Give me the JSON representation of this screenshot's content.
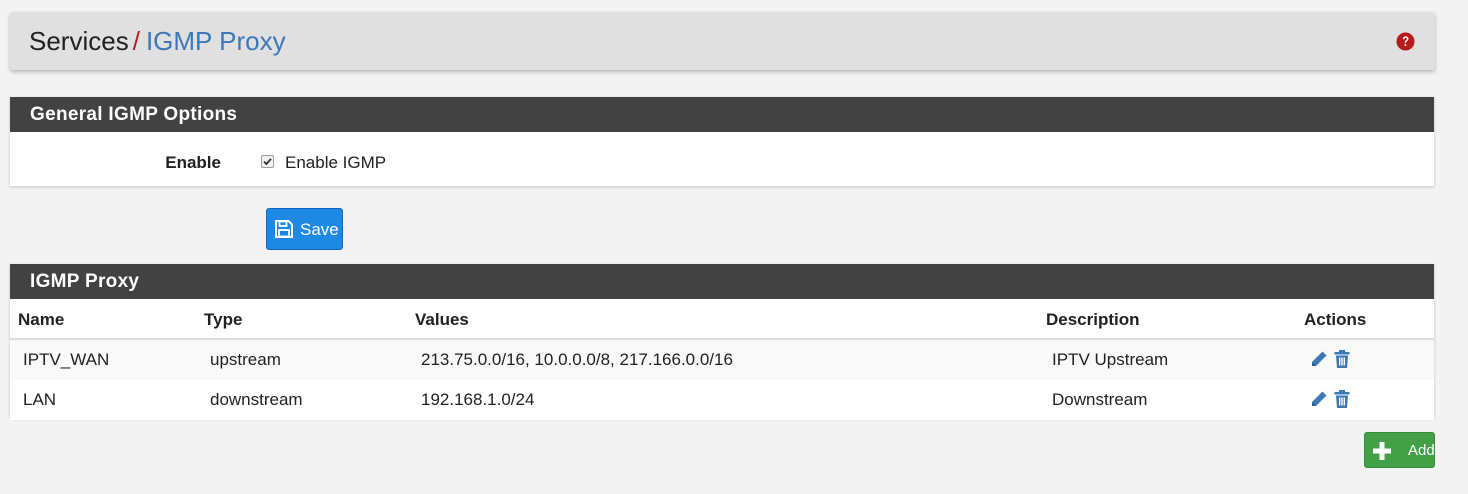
{
  "breadcrumb": {
    "parent": "Services",
    "separator": "/",
    "current": "IGMP Proxy",
    "help_icon": "question-circle-icon"
  },
  "general_panel": {
    "title": "General IGMP Options",
    "enable_label": "Enable",
    "enable_checkbox_label": "Enable IGMP",
    "enable_checked": true
  },
  "save_button": {
    "label": "Save",
    "icon": "floppy-disk-icon"
  },
  "proxy_panel": {
    "title": "IGMP Proxy",
    "columns": [
      "Name",
      "Type",
      "Values",
      "Description",
      "Actions"
    ],
    "rows": [
      {
        "name": "IPTV_WAN",
        "type": "upstream",
        "values": "213.75.0.0/16, 10.0.0.0/8, 217.166.0.0/16",
        "description": "IPTV Upstream"
      },
      {
        "name": "LAN",
        "type": "downstream",
        "values": "192.168.1.0/24",
        "description": "Downstream"
      }
    ],
    "action_icons": [
      "pencil-icon",
      "trash-icon"
    ]
  },
  "add_button": {
    "label": "Add",
    "icon": "plus-icon"
  },
  "colors": {
    "header_bar": "#424242",
    "breadcrumb_separator": "#b71c1c",
    "breadcrumb_current": "#3c78b8",
    "save_button": "#1e88e5",
    "add_button": "#43a047",
    "action_icon": "#3c78b8"
  }
}
